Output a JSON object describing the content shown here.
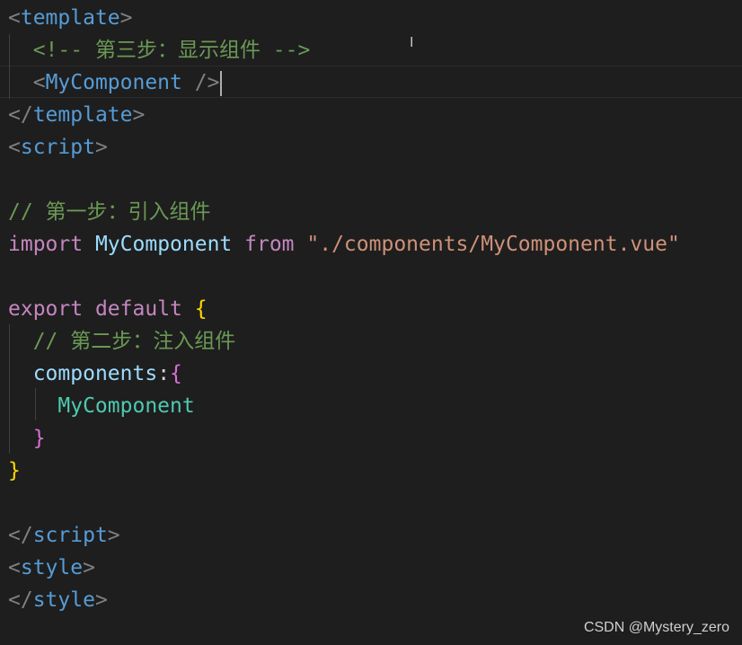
{
  "code_lines": [
    [
      {
        "t": "<",
        "c": "punct"
      },
      {
        "t": "template",
        "c": "tag"
      },
      {
        "t": ">",
        "c": "punct"
      }
    ],
    [
      {
        "t": "  "
      },
      {
        "t": "<!-- 第三步：显示组件 -->",
        "c": "comment"
      }
    ],
    [
      {
        "t": "  "
      },
      {
        "t": "<",
        "c": "punct"
      },
      {
        "t": "MyComponent",
        "c": "tag"
      },
      {
        "t": " />",
        "c": "punct"
      }
    ],
    [
      {
        "t": "</",
        "c": "punct"
      },
      {
        "t": "template",
        "c": "tag"
      },
      {
        "t": ">",
        "c": "punct"
      }
    ],
    [
      {
        "t": "<",
        "c": "punct"
      },
      {
        "t": "script",
        "c": "tag"
      },
      {
        "t": ">",
        "c": "punct"
      }
    ],
    [],
    [
      {
        "t": "// 第一步：引入组件",
        "c": "comment"
      }
    ],
    [
      {
        "t": "import",
        "c": "keyword"
      },
      {
        "t": " "
      },
      {
        "t": "MyComponent",
        "c": "ident"
      },
      {
        "t": " "
      },
      {
        "t": "from",
        "c": "keyword"
      },
      {
        "t": " "
      },
      {
        "t": "\"./components/MyComponent.vue\"",
        "c": "string"
      }
    ],
    [],
    [
      {
        "t": "export",
        "c": "keyword"
      },
      {
        "t": " "
      },
      {
        "t": "default",
        "c": "keyword"
      },
      {
        "t": " "
      },
      {
        "t": "{",
        "c": "brace1"
      }
    ],
    [
      {
        "t": "  "
      },
      {
        "t": "// 第二步：注入组件",
        "c": "comment"
      }
    ],
    [
      {
        "t": "  "
      },
      {
        "t": "components",
        "c": "prop"
      },
      {
        "t": ":",
        "c": "plain"
      },
      {
        "t": "{",
        "c": "brace2"
      }
    ],
    [
      {
        "t": "    "
      },
      {
        "t": "MyComponent",
        "c": "comp"
      }
    ],
    [
      {
        "t": "  "
      },
      {
        "t": "}",
        "c": "brace2"
      }
    ],
    [
      {
        "t": "}",
        "c": "brace1"
      }
    ],
    [],
    [
      {
        "t": "</",
        "c": "punct"
      },
      {
        "t": "script",
        "c": "tag"
      },
      {
        "t": ">",
        "c": "punct"
      }
    ],
    [
      {
        "t": "<",
        "c": "punct"
      },
      {
        "t": "style",
        "c": "tag"
      },
      {
        "t": ">",
        "c": "punct"
      }
    ],
    [
      {
        "t": "</",
        "c": "punct"
      },
      {
        "t": "style",
        "c": "tag"
      },
      {
        "t": ">",
        "c": "punct"
      }
    ]
  ],
  "cursor_line": 3,
  "watermark": "CSDN @Mystery_zero",
  "colors": {
    "background": "#1e1e1e",
    "tag": "#569cd6",
    "punct": "#808080",
    "comment": "#6a9955",
    "keyword": "#c586c0",
    "identifier": "#9cdcfe",
    "string": "#ce9178",
    "brace_level1": "#ffd700",
    "brace_level2": "#da70d6",
    "component": "#4ec9b0"
  }
}
